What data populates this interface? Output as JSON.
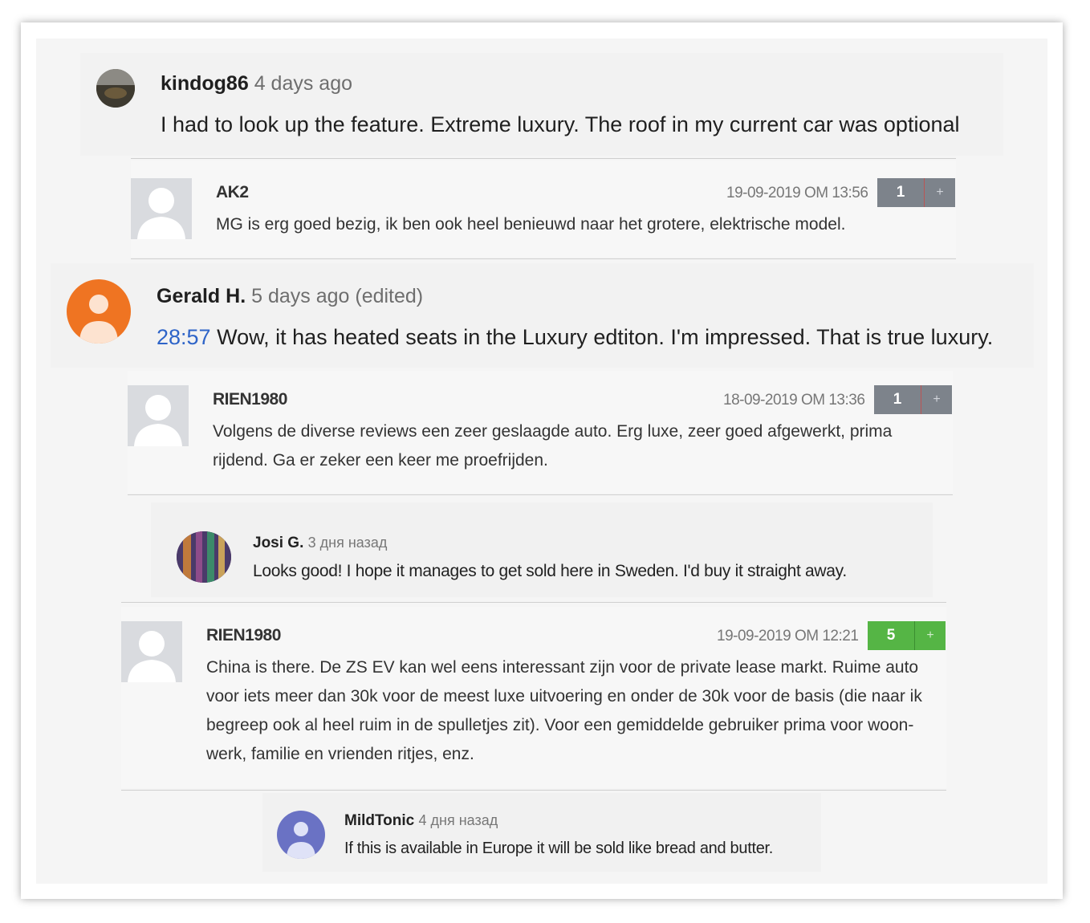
{
  "comments": [
    {
      "author": "kindog86",
      "time": "4 days ago",
      "text": "I had to look up the feature. Extreme luxury. The roof in my current car was optional"
    },
    {
      "author": "AK2",
      "date": "19-09-2019 OM 13:56",
      "votes": "1",
      "plus": "+",
      "text": "MG is erg goed bezig, ik ben ook heel benieuwd naar het grotere, elektrische model."
    },
    {
      "author": "Gerald H.",
      "time": "5 days ago (edited)",
      "timestamp_link": "28:57",
      "text": " Wow, it has heated seats in the Luxury edtiton. I'm impressed. That is true luxury."
    },
    {
      "author": "RIEN1980",
      "date": "18-09-2019 OM 13:36",
      "votes": "1",
      "plus": "+",
      "text": "Volgens de diverse reviews een zeer geslaagde auto. Erg luxe, zeer goed afgewerkt, prima rijdend. Ga er zeker een keer me proefrijden."
    },
    {
      "author": "Josi G.",
      "time": "3 дня назад",
      "text": "Looks good! I hope it manages to get sold here in Sweden. I'd buy it straight away."
    },
    {
      "author": "RIEN1980",
      "date": "19-09-2019 OM 12:21",
      "votes": "5",
      "plus": "+",
      "text": "China is there. De ZS EV kan wel eens interessant zijn voor de private lease markt. Ruime auto voor iets meer dan 30k voor de meest luxe uitvoering en onder de 30k voor de basis (die naar ik begreep ook al heel ruim in de spulletjes zit). Voor een gemiddelde gebruiker prima voor woon-werk, familie en vrienden ritjes, enz."
    },
    {
      "author": "MildTonic",
      "time": "4 дня назад",
      "text": "If this is available in Europe it will be sold like bread and butter."
    }
  ],
  "colors": {
    "vote_gray": "#7d838b",
    "vote_green": "#55b545",
    "link_blue": "#2e64c8",
    "avatar_orange": "#ef7422",
    "avatar_purple": "#6a72c4"
  }
}
